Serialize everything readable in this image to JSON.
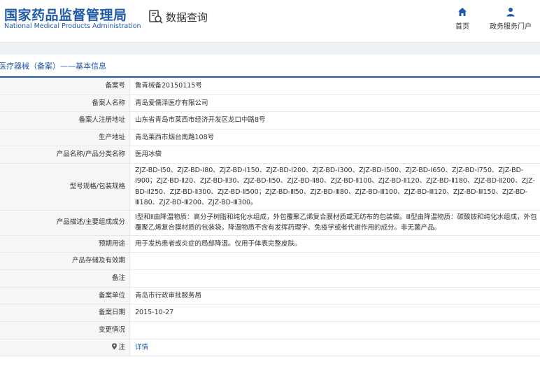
{
  "header": {
    "logo_cn": "国家药品监督管理局",
    "logo_en": "National Medical Products Administration",
    "query_label": "数据查询",
    "nav_home": "首页",
    "nav_portal": "政务服务门户"
  },
  "page_title": "医疗器械（备案）——基本信息",
  "rows": [
    {
      "label": "备案号",
      "value": "鲁青械备20150115号"
    },
    {
      "label": "备案人名称",
      "value": "青岛爱儒泽医疗有限公司"
    },
    {
      "label": "备案人注册地址",
      "value": "山东省青岛市莱西市经济开发区龙口中路8号"
    },
    {
      "label": "生产地址",
      "value": "青岛莱西市烟台南路108号"
    },
    {
      "label": "产品名称/产品分类名称",
      "value": "医用冰袋"
    },
    {
      "label": "型号规格/包装规格",
      "value": "ZJZ-BD-Ⅰ50、ZJZ-BD-Ⅰ80、ZJZ-BD-Ⅰ150、ZJZ-BD-Ⅰ200、ZJZ-BD-Ⅰ300、ZJZ-BD-Ⅰ500、ZJZ-BD-Ⅰ650、ZJZ-BD-Ⅰ750、ZJZ-BD-Ⅰ900；ZJZ-BD-Ⅱ20、ZJZ-BD-Ⅱ30、ZJZ-BD-Ⅱ50、ZJZ-BD-Ⅱ80、ZJZ-BD-Ⅱ100、ZJZ-BD-Ⅱ120、ZJZ-BD-Ⅱ180、ZJZ-BD-Ⅱ200、ZJZ-BD-Ⅱ250、ZJZ-BD-Ⅱ300、ZJZ-BD-Ⅱ500；ZJZ-BD-Ⅲ50、ZJZ-BD-Ⅲ80、ZJZ-BD-Ⅲ100、ZJZ-BD-Ⅲ120、ZJZ-BD-Ⅲ150、ZJZ-BD-Ⅲ180、ZJZ-BD-Ⅲ200、ZJZ-BD-Ⅲ300。"
    },
    {
      "label": "产品描述/主要组成成分",
      "value": "Ⅰ型和Ⅱ由降温物质：高分子树脂和纯化水组成，外包覆聚乙烯复合膜材质或无纺布的包装袋。Ⅲ型由降温物质：碳酸铵和纯化水组成，外包覆聚乙烯复合膜材质的包装袋。降温物质不含有发挥药理学、免疫学或者代谢作用的成分。非无菌产品。"
    },
    {
      "label": "预期用途",
      "value": "用于发热患者或炎症的局部降温。仅用于体表完整皮肤。"
    },
    {
      "label": "产品存储及有效期",
      "value": ""
    },
    {
      "label": "备注",
      "value": ""
    },
    {
      "label": "备案单位",
      "value": "青岛市行政审批服务局"
    },
    {
      "label": "备案日期",
      "value": "2015-10-27"
    },
    {
      "label": "变更情况",
      "value": ""
    }
  ],
  "note_row": {
    "label": "注",
    "value": "详情"
  },
  "colors": {
    "brand": "#1f5aa8",
    "label_bg": "#f5f6f8",
    "border": "#e6e8ec"
  }
}
